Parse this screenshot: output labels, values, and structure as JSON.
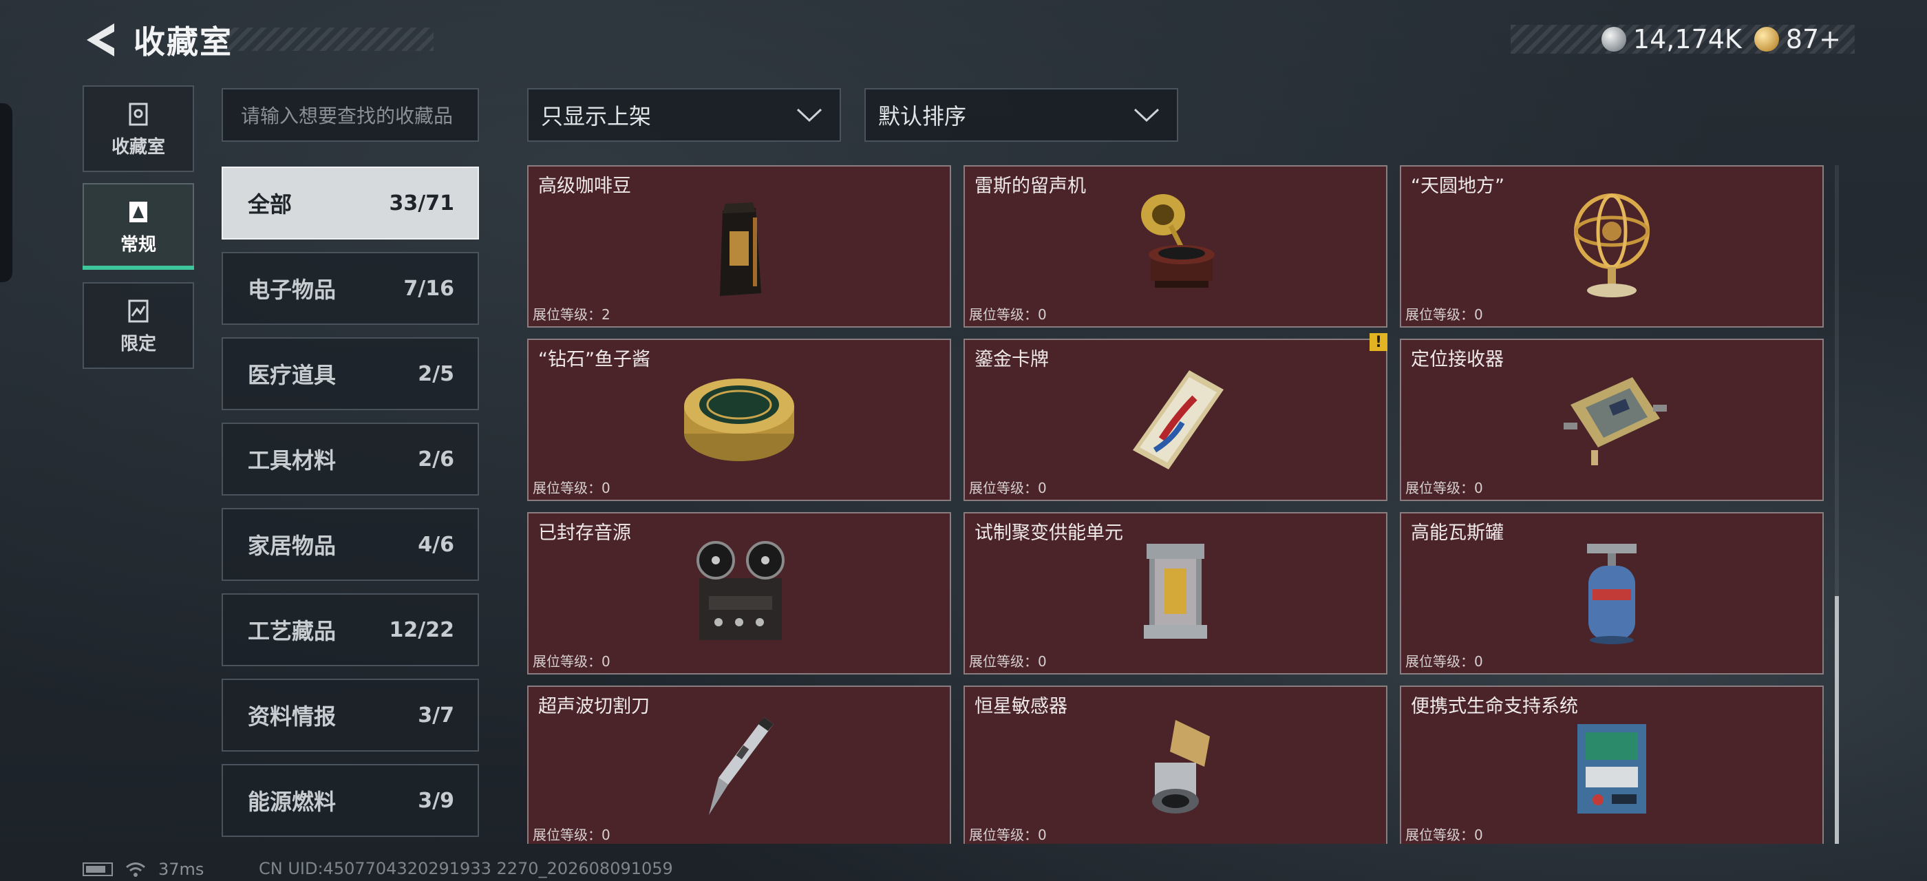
{
  "header": {
    "title": "收藏室",
    "currency": [
      {
        "icon": "silver-coin-icon",
        "value": "14,174K"
      },
      {
        "icon": "gold-coin-icon",
        "value": "87+"
      }
    ]
  },
  "rail": {
    "tabs": [
      {
        "label": "收藏室",
        "icon": "collection-icon",
        "active": false
      },
      {
        "label": "常规",
        "icon": "regular-icon",
        "active": true
      },
      {
        "label": "限定",
        "icon": "limited-icon",
        "active": false
      }
    ]
  },
  "search": {
    "placeholder": "请输入想要查找的收藏品"
  },
  "filters": {
    "display_filter": "只显示上架",
    "sort": "默认排序"
  },
  "categories": [
    {
      "label": "全部",
      "count": "33/71",
      "active": true
    },
    {
      "label": "电子物品",
      "count": "7/16",
      "active": false
    },
    {
      "label": "医疗道具",
      "count": "2/5",
      "active": false
    },
    {
      "label": "工具材料",
      "count": "2/6",
      "active": false
    },
    {
      "label": "家居物品",
      "count": "4/6",
      "active": false
    },
    {
      "label": "工艺藏品",
      "count": "12/22",
      "active": false
    },
    {
      "label": "资料情报",
      "count": "3/7",
      "active": false
    },
    {
      "label": "能源燃料",
      "count": "3/9",
      "active": false
    }
  ],
  "items": [
    {
      "name": "高级咖啡豆",
      "level": "展位等级：2",
      "icon": "coffee-bag-icon"
    },
    {
      "name": "雷斯的留声机",
      "level": "展位等级：0",
      "icon": "gramophone-icon"
    },
    {
      "name": "“天圆地方”",
      "level": "展位等级：0",
      "icon": "armillary-sphere-icon"
    },
    {
      "name": "“钻石”鱼子酱",
      "level": "展位等级：0",
      "icon": "caviar-tin-icon"
    },
    {
      "name": "鎏金卡牌",
      "level": "展位等级：0",
      "icon": "gilded-card-icon"
    },
    {
      "name": "定位接收器",
      "level": "展位等级：0",
      "icon": "receiver-icon"
    },
    {
      "name": "已封存音源",
      "level": "展位等级：0",
      "icon": "reel-recorder-icon"
    },
    {
      "name": "试制聚变供能单元",
      "level": "展位等级：0",
      "icon": "fusion-cell-icon"
    },
    {
      "name": "高能瓦斯罐",
      "level": "展位等级：0",
      "icon": "gas-canister-icon"
    },
    {
      "name": "超声波切割刀",
      "level": "展位等级：0",
      "icon": "ultrasonic-knife-icon"
    },
    {
      "name": "恒星敏感器",
      "level": "展位等级：0",
      "icon": "star-sensor-icon"
    },
    {
      "name": "便携式生命支持系统",
      "level": "展位等级：0",
      "icon": "life-support-icon"
    }
  ],
  "warning_badge": "!",
  "status": {
    "ping": "37ms",
    "uid": "CN UID:4507704320291933 2270_202608091059"
  },
  "colors": {
    "card_bg": "#4a2429",
    "accent": "#3fc59a",
    "gold": "#e2b322"
  }
}
